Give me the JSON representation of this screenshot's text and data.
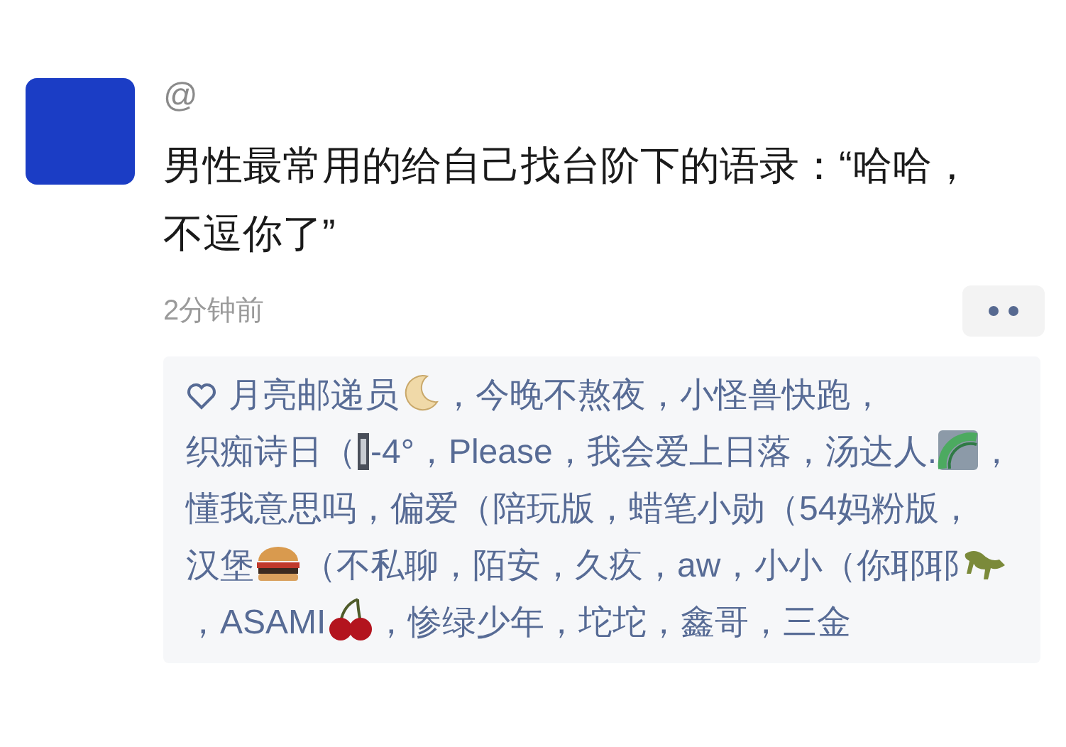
{
  "post": {
    "at": "@",
    "text": "男性最常用的给自己找台阶下的语录：“哈哈，不逗你了”",
    "time": "2分钟前"
  },
  "likes": [
    {
      "name": "月亮邮递员",
      "kind": "moon",
      "after": "，"
    },
    {
      "name": "今晚不熬夜，"
    },
    {
      "name": "小怪兽快跑，"
    },
    {
      "name": "织痴诗日（",
      "kind": "tag",
      "after": "-4°，"
    },
    {
      "name": "Please，"
    },
    {
      "name": "我会爱上日落，"
    },
    {
      "name": "汤达人.",
      "kind": "rainbow",
      "after": "，"
    },
    {
      "name": "懂我意思吗，"
    },
    {
      "name": "偏爱（陪玩版，"
    },
    {
      "name": "蜡笔小勋（54妈粉版，"
    },
    {
      "name": "汉堡",
      "kind": "burger",
      "after": "（不私聊，"
    },
    {
      "name": "陌安，"
    },
    {
      "name": "久疚，"
    },
    {
      "name": "aw，"
    },
    {
      "name": "小小（你耶耶",
      "kind": "dino",
      "after": "，"
    },
    {
      "name": "ASAMI",
      "kind": "cherry",
      "after": "，"
    },
    {
      "name": "惨绿少年，"
    },
    {
      "name": "坨坨，"
    },
    {
      "name": "鑫哥，"
    },
    {
      "name": "三金"
    }
  ]
}
